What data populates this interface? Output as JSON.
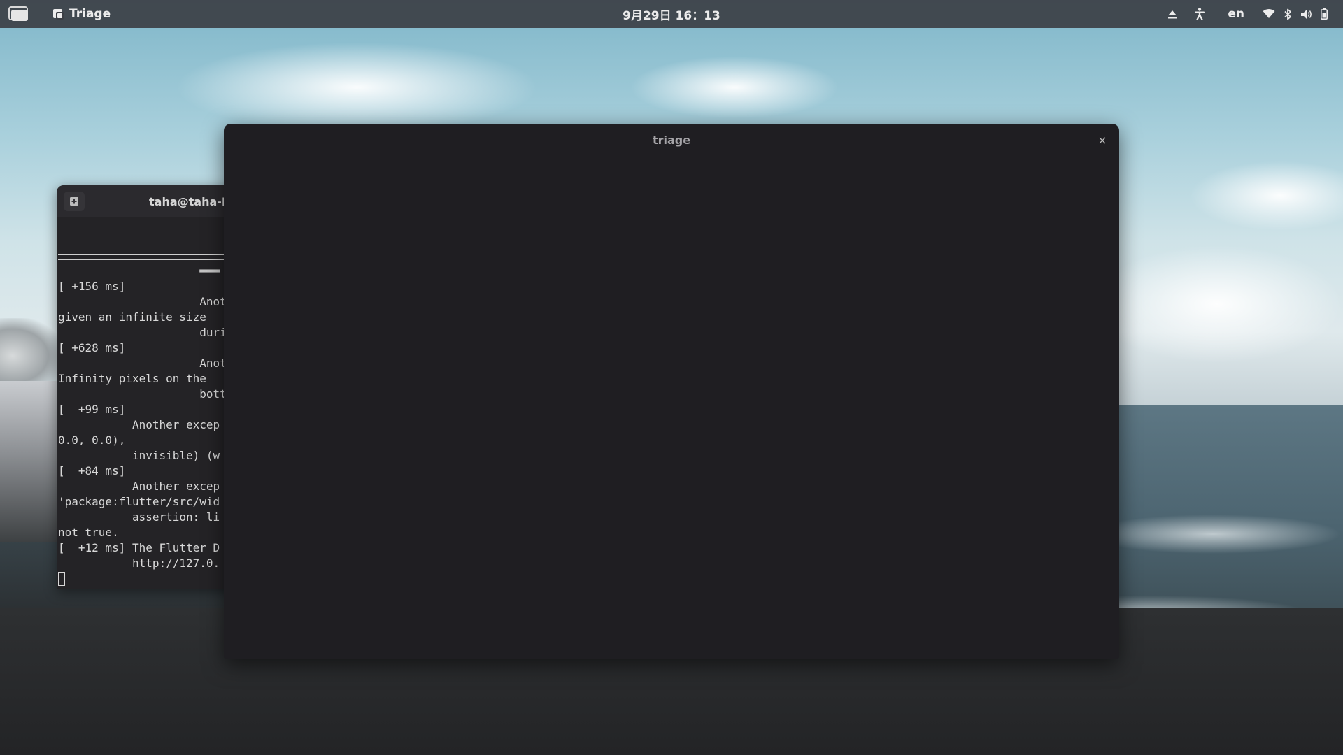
{
  "topbar": {
    "app_name": "Triage",
    "clock": "9月29日  16：13",
    "language": "en"
  },
  "terminal": {
    "title": "taha@taha-L",
    "lines": [
      "                     ═══",
      "[ +156 ms]",
      "                     Anot",
      "given an infinite size",
      "                     duri",
      "[ +628 ms]",
      "                     Anot",
      "Infinity pixels on the",
      "                     bott",
      "[  +99 ms]",
      "           Another excep",
      "0.0, 0.0),",
      "           invisible) (w",
      "[  +84 ms]",
      "           Another excep",
      "'package:flutter/src/wid",
      "           assertion: li",
      "not true.",
      "[  +12 ms] The Flutter D",
      "           http://127.0."
    ]
  },
  "dialog": {
    "title": "triage",
    "close_label": "×"
  },
  "colors": {
    "topbar_bg": "#3c3f45",
    "dialog_bg": "#1f1e22",
    "terminal_bg": "#242326"
  },
  "icons": {
    "activities": "window-stack-icon",
    "app": "triage-app-icon",
    "tray": [
      "eject-icon",
      "accessibility-icon",
      "wifi-icon",
      "bluetooth-icon",
      "volume-icon",
      "battery-icon"
    ]
  }
}
